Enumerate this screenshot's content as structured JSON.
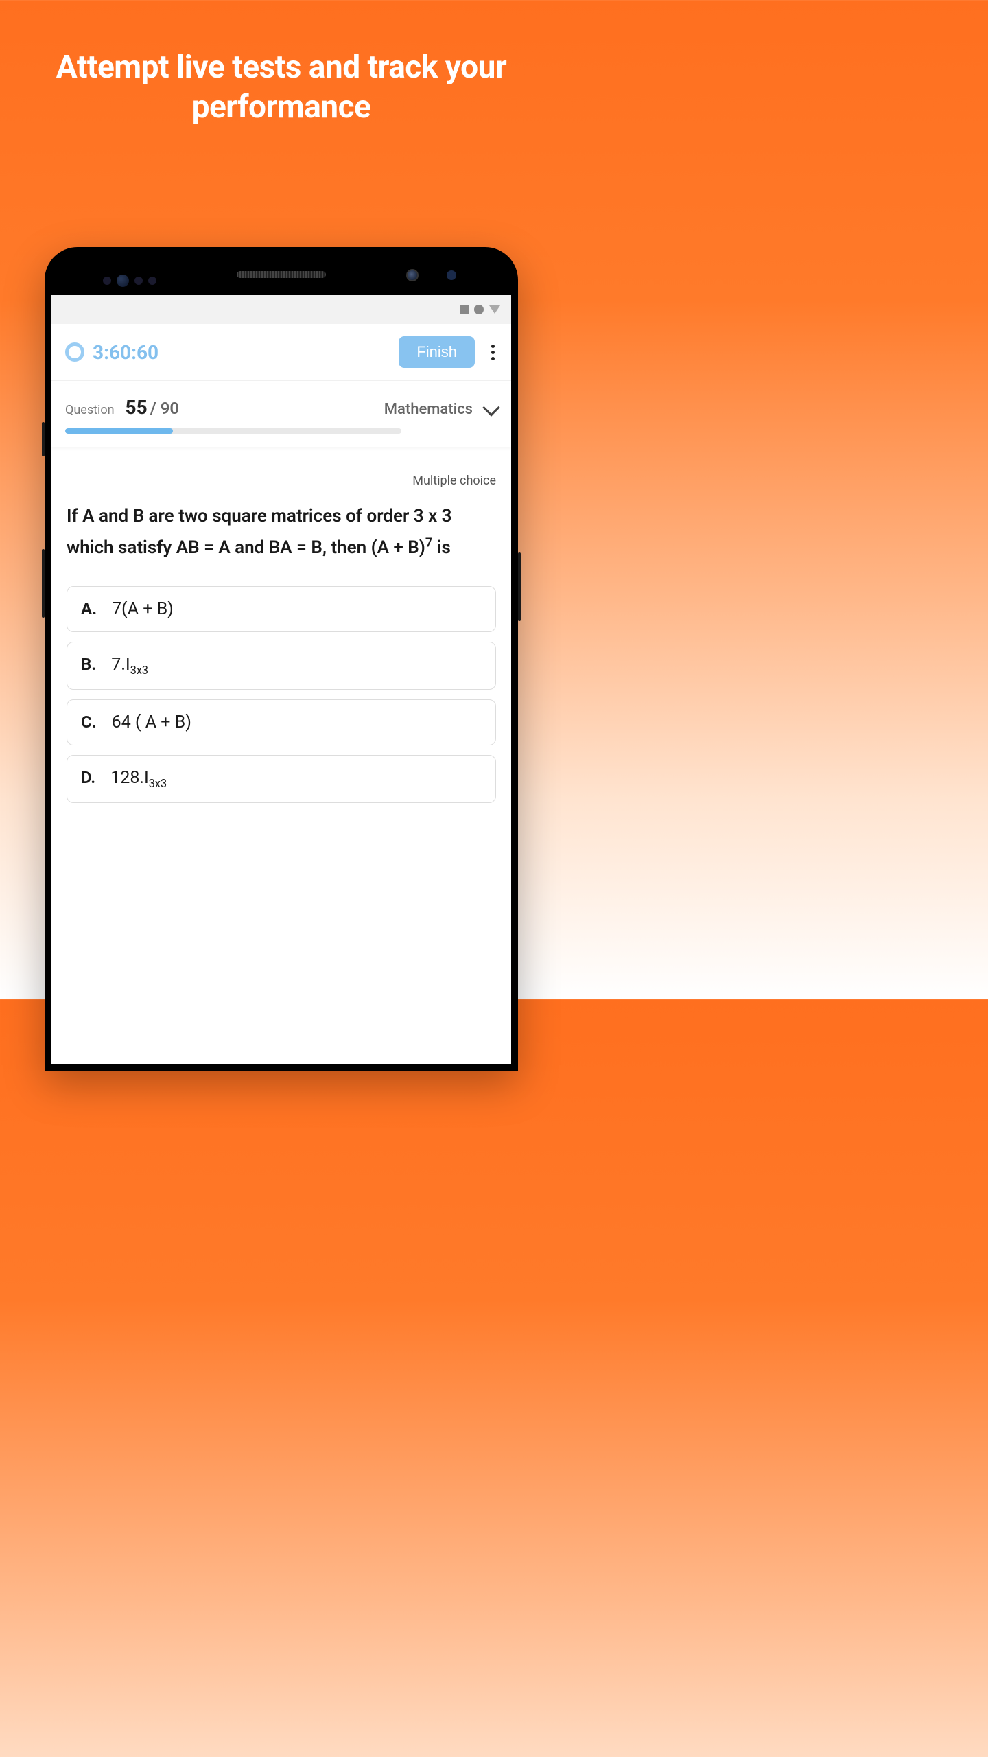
{
  "headline": "Attempt live tests and track your performance",
  "timer": "3:60:60",
  "finish_label": "Finish",
  "progress": {
    "label": "Question",
    "current": "55",
    "separator": " / ",
    "total": "90",
    "subject": "Mathematics",
    "percent": 32
  },
  "question": {
    "type": "Multiple choice",
    "text_parts": {
      "pre": "If A and B are two square matrices of order 3 x 3 which satisfy AB = A and BA = B, then (A + B)",
      "sup": "7",
      "post": " is"
    },
    "options": [
      {
        "letter": "A.",
        "text": "7(A + B)",
        "sub": ""
      },
      {
        "letter": "B.",
        "text": "7.I",
        "sub": "3x3"
      },
      {
        "letter": "C.",
        "text": "64 ( A + B)",
        "sub": ""
      },
      {
        "letter": "D.",
        "text": "128.I",
        "sub": "3x3"
      }
    ]
  }
}
